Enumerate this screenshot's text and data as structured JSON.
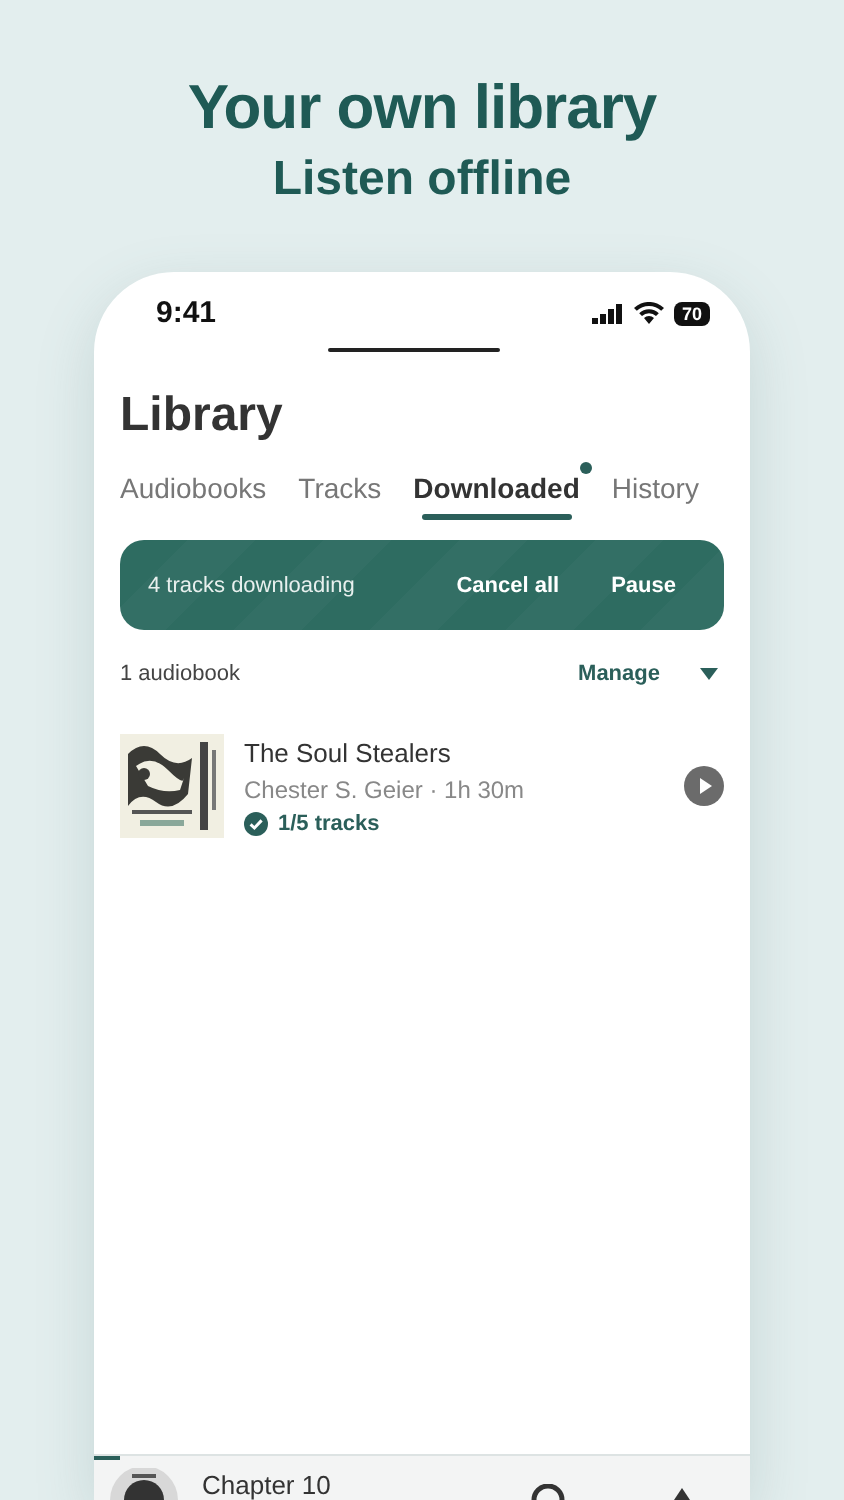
{
  "headline": {
    "title": "Your own library",
    "subtitle": "Listen offline"
  },
  "status_bar": {
    "time": "9:41",
    "battery": "70"
  },
  "screen_title": "Library",
  "tabs": [
    {
      "label": "Audiobooks",
      "selected": false,
      "dot": false
    },
    {
      "label": "Tracks",
      "selected": false,
      "dot": false
    },
    {
      "label": "Downloaded",
      "selected": true,
      "dot": true
    },
    {
      "label": "History",
      "selected": false,
      "dot": false
    }
  ],
  "download_banner": {
    "text": "4 tracks downloading",
    "actions": [
      "Cancel all",
      "Pause"
    ]
  },
  "list_header": {
    "count": "1 audiobook",
    "action": "Manage"
  },
  "books": [
    {
      "title": "The Soul Stealers",
      "meta": "Chester S. Geier · 1h 30m",
      "progress": "1/5 tracks",
      "downloaded": true
    }
  ],
  "mini_player": {
    "title": "Chapter 10",
    "level": 0.04
  }
}
